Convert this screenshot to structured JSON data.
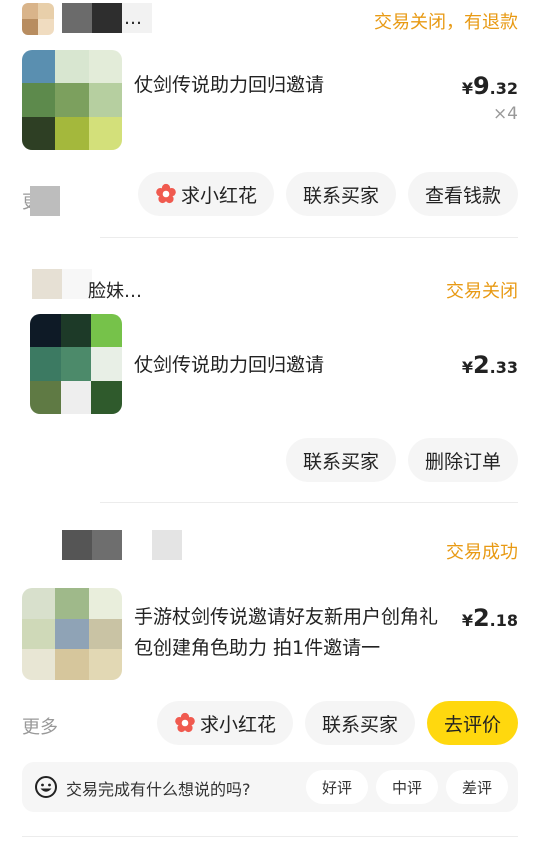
{
  "colors": {
    "status": "#e89a14",
    "primary_button": "#ffd80e",
    "button_bg": "#f5f5f5",
    "muted": "#999999"
  },
  "orders": [
    {
      "buyer_name": "…",
      "status": "交易关闭，有退款",
      "product_title": "仗剑传说助力回归邀请",
      "price": {
        "currency": "¥",
        "integer": "9",
        "decimal": ".32"
      },
      "quantity": "×4",
      "more_label": "更",
      "actions": [
        {
          "label": "求小红花",
          "icon": "flower-icon"
        },
        {
          "label": "联系买家"
        },
        {
          "label": "查看钱款"
        }
      ]
    },
    {
      "buyer_name": "脸妹…",
      "status": "交易关闭",
      "product_title": "仗剑传说助力回归邀请",
      "price": {
        "currency": "¥",
        "integer": "2",
        "decimal": ".33"
      },
      "actions": [
        {
          "label": "联系买家"
        },
        {
          "label": "删除订单"
        }
      ]
    },
    {
      "buyer_name": "",
      "status": "交易成功",
      "product_title": "手游杖剑传说邀请好友新用户创角礼包创建角色助力 拍1件邀请一",
      "price": {
        "currency": "¥",
        "integer": "2",
        "decimal": ".18"
      },
      "more_label": "更多",
      "actions": [
        {
          "label": "求小红花",
          "icon": "flower-icon"
        },
        {
          "label": "联系买家"
        },
        {
          "label": "去评价",
          "primary": true
        }
      ],
      "feedback": {
        "prompt": "交易完成有什么想说的吗?",
        "icon": "smiley-icon",
        "ratings": [
          "好评",
          "中评",
          "差评"
        ]
      }
    }
  ]
}
